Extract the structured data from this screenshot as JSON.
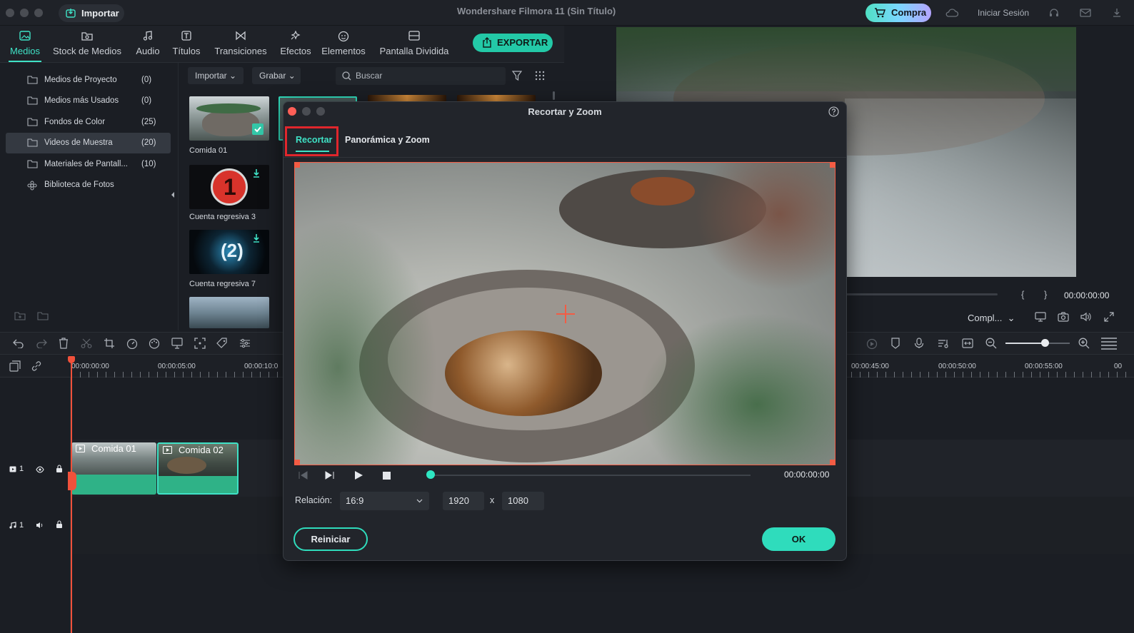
{
  "titlebar": {
    "import_label": "Importar",
    "app_title": "Wondershare Filmora 11 (Sin Título)",
    "buy_label": "Compra",
    "signin_label": "Iniciar Sesión"
  },
  "nav": {
    "tabs": [
      {
        "label": "Medios",
        "icon": "media-icon"
      },
      {
        "label": "Stock de Medios",
        "icon": "stock-media-icon"
      },
      {
        "label": "Audio",
        "icon": "music-note-icon"
      },
      {
        "label": "Títulos",
        "icon": "titles-icon"
      },
      {
        "label": "Transiciones",
        "icon": "transitions-icon"
      },
      {
        "label": "Efectos",
        "icon": "effects-icon"
      },
      {
        "label": "Elementos",
        "icon": "elements-icon"
      },
      {
        "label": "Pantalla Dividida",
        "icon": "split-screen-icon"
      }
    ],
    "export_label": "EXPORTAR"
  },
  "sidebar": {
    "items": [
      {
        "label": "Medios de Proyecto",
        "count": "(0)"
      },
      {
        "label": "Medios más Usados",
        "count": "(0)"
      },
      {
        "label": "Fondos de Color",
        "count": "(25)"
      },
      {
        "label": "Videos de Muestra",
        "count": "(20)"
      },
      {
        "label": "Materiales de Pantall...",
        "count": "(10)"
      },
      {
        "label": "Biblioteca de Fotos",
        "count": ""
      }
    ]
  },
  "media_toolbar": {
    "import_dropdown": "Importar",
    "record_dropdown": "Grabar",
    "search_placeholder": "Buscar"
  },
  "media": {
    "items": [
      {
        "label": "Comida 01"
      },
      {
        "label": "Cuenta regresiva 3"
      },
      {
        "label": "Cuenta regresiva 7"
      }
    ]
  },
  "preview": {
    "timecode": "00:00:00:00",
    "quality": "Compl...",
    "bracket_in": "{",
    "bracket_out": "}"
  },
  "timeline": {
    "ruler_left": [
      "00:00:00:00",
      "00:00:05:00",
      "00:00:10:0"
    ],
    "ruler_right": [
      "00:00:45:00",
      "00:00:50:00",
      "00:00:55:00",
      "00"
    ],
    "video_track": "1",
    "audio_track": "1",
    "clips": [
      {
        "label": "Comida 01"
      },
      {
        "label": "Comida 02"
      }
    ]
  },
  "dialog": {
    "title": "Recortar y Zoom",
    "tabs": [
      "Recortar",
      "Panorámica y Zoom"
    ],
    "timecode": "00:00:00:00",
    "ratio_label": "Relación:",
    "ratio_value": "16:9",
    "width": "1920",
    "height": "1080",
    "times": "x",
    "reset_label": "Reiniciar",
    "ok_label": "OK",
    "playhead_progress": 0
  },
  "colors": {
    "accent": "#2fdcbc",
    "crop_border": "#f35c44",
    "highlight_box": "#e0262c"
  }
}
